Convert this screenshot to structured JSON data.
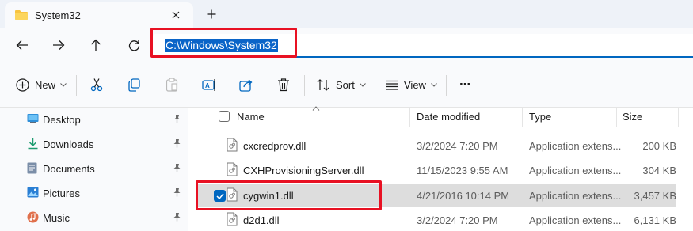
{
  "window": {
    "tab_title": "System32",
    "new_tab_label": "+"
  },
  "address_bar": {
    "path": "C:\\Windows\\System32"
  },
  "toolbar": {
    "new_label": "New",
    "sort_label": "Sort",
    "view_label": "View",
    "more_label": "···"
  },
  "sidebar": {
    "items": [
      {
        "label": "Desktop",
        "icon": "desktop-icon"
      },
      {
        "label": "Downloads",
        "icon": "download-icon"
      },
      {
        "label": "Documents",
        "icon": "documents-icon"
      },
      {
        "label": "Pictures",
        "icon": "pictures-icon"
      },
      {
        "label": "Music",
        "icon": "music-icon"
      }
    ]
  },
  "file_list": {
    "columns": {
      "name": "Name",
      "date": "Date modified",
      "type": "Type",
      "size": "Size"
    },
    "rows": [
      {
        "name": "cxcredprov.dll",
        "date": "3/2/2024 7:20 PM",
        "type": "Application extens...",
        "size": "200 KB",
        "selected": false
      },
      {
        "name": "CXHProvisioningServer.dll",
        "date": "11/15/2023 9:55 AM",
        "type": "Application extens...",
        "size": "304 KB",
        "selected": false
      },
      {
        "name": "cygwin1.dll",
        "date": "4/21/2016 10:14 PM",
        "type": "Application extens...",
        "size": "3,457 KB",
        "selected": true
      },
      {
        "name": "d2d1.dll",
        "date": "3/2/2024 7:20 PM",
        "type": "Application extens...",
        "size": "6,131 KB",
        "selected": false
      }
    ]
  },
  "colors": {
    "accent": "#0067c0",
    "highlight_box": "#e81123",
    "selection_bg": "#dddddd"
  }
}
